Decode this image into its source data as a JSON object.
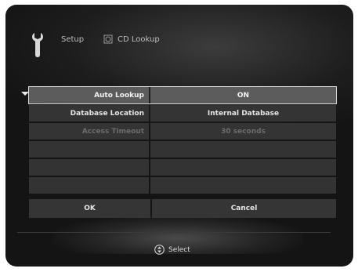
{
  "header": {
    "section_label": "Setup",
    "page_label": "CD Lookup",
    "section_icon": "wrench-icon",
    "page_icon": "cd-icon"
  },
  "settings": [
    {
      "label": "Auto Lookup",
      "value": "ON",
      "state": "selected"
    },
    {
      "label": "Database Location",
      "value": "Internal Database",
      "state": "normal"
    },
    {
      "label": "Access Timeout",
      "value": "30 seconds",
      "state": "disabled"
    }
  ],
  "buttons": {
    "ok_label": "OK",
    "cancel_label": "Cancel"
  },
  "footer": {
    "select_label": "Select",
    "select_icon": "dpad-updown-icon"
  }
}
